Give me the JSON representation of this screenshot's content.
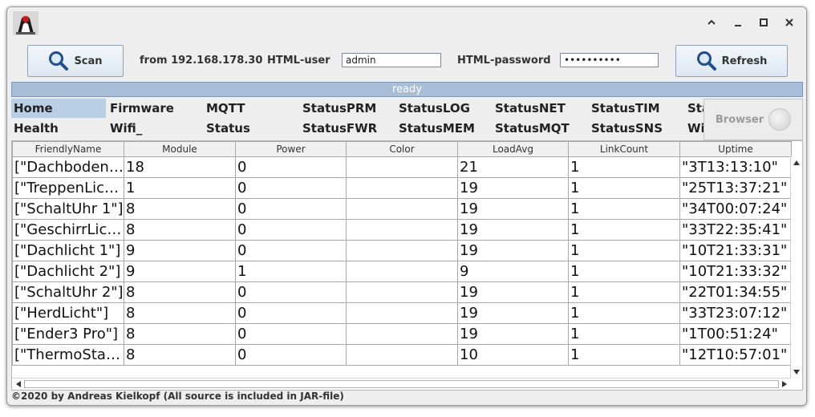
{
  "window": {
    "icon": "java-duke-icon",
    "controls": [
      "chevron-up-icon",
      "minimize-icon",
      "maximize-icon",
      "close-icon"
    ]
  },
  "toolbar": {
    "scan_label": "Scan",
    "from_label": "from 192.168.178.30",
    "user_label": "HTML-user",
    "user_value": "admin",
    "password_label": "HTML-password",
    "password_value": "••••••••••",
    "refresh_label": "Refresh"
  },
  "status": "ready",
  "nav": {
    "row1": [
      "Home",
      "Firmware",
      "MQTT",
      "StatusPRM",
      "StatusLOG",
      "StatusNET",
      "StatusTIM",
      "StatusSTS"
    ],
    "row2": [
      "Health",
      "Wifi_",
      "Status",
      "StatusFWR",
      "StatusMEM",
      "StatusMQT",
      "StatusSNS",
      "Wifi"
    ],
    "selected": "Home"
  },
  "browser_label": "Browser",
  "table": {
    "columns": [
      "FriendlyName",
      "Module",
      "Power",
      "Color",
      "LoadAvg",
      "LinkCount",
      "Uptime"
    ],
    "rows": [
      [
        "[\"Dachbodenlicht\"]",
        "18",
        "0",
        "",
        "21",
        "1",
        "\"3T13:13:10\""
      ],
      [
        "[\"TreppenLicht\"]",
        "1",
        "0",
        "",
        "19",
        "1",
        "\"25T13:37:21\""
      ],
      [
        "[\"SchaltUhr 1\"]",
        "8",
        "0",
        "",
        "19",
        "1",
        "\"34T00:07:24\""
      ],
      [
        "[\"GeschirrLicht\"]",
        "8",
        "0",
        "",
        "19",
        "1",
        "\"33T22:35:41\""
      ],
      [
        "[\"Dachlicht 1\"]",
        "9",
        "0",
        "",
        "19",
        "1",
        "\"10T21:33:31\""
      ],
      [
        "[\"Dachlicht 2\"]",
        "9",
        "1",
        "",
        "9",
        "1",
        "\"10T21:33:32\""
      ],
      [
        "[\"SchaltUhr 2\"]",
        "8",
        "0",
        "",
        "19",
        "1",
        "\"22T01:34:55\""
      ],
      [
        "[\"HerdLicht\"]",
        "8",
        "0",
        "",
        "19",
        "1",
        "\"33T23:07:12\""
      ],
      [
        "[\"Ender3 Pro\"]",
        "8",
        "0",
        "",
        "19",
        "1",
        "\"1T00:51:24\""
      ],
      [
        "[\"ThermoStat\"]",
        "8",
        "0",
        "",
        "10",
        "1",
        "\"12T10:57:01\""
      ]
    ]
  },
  "footer": "©2020 by Andreas Kielkopf (All source is included in JAR-file)",
  "colors": {
    "statusbar": "#a8bed6",
    "selected_tab": "#b8cfe5",
    "button_border": "#8aa0bd"
  }
}
